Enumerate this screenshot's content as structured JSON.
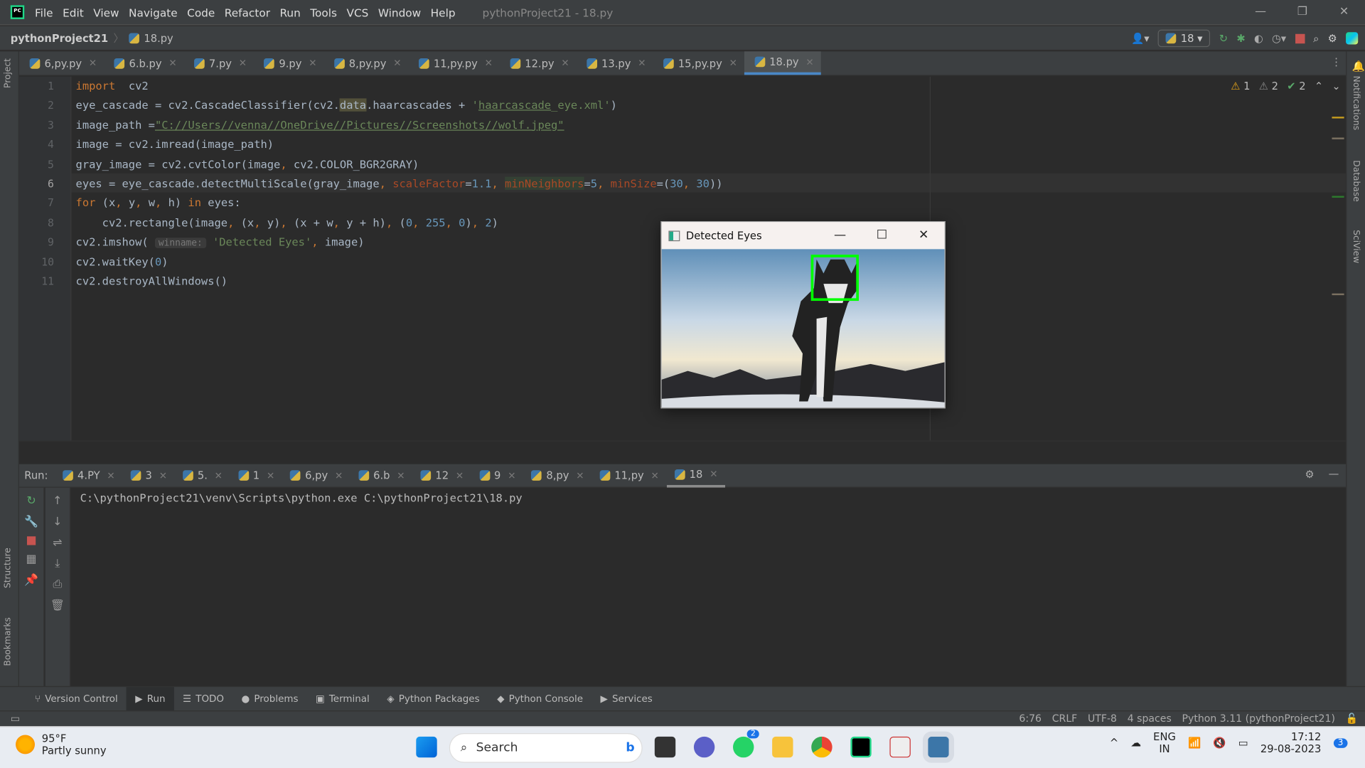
{
  "menubar": {
    "items": [
      "File",
      "Edit",
      "View",
      "Navigate",
      "Code",
      "Refactor",
      "Run",
      "Tools",
      "VCS",
      "Window",
      "Help"
    ],
    "title": "pythonProject21 - 18.py"
  },
  "navbar": {
    "project": "pythonProject21",
    "file": "18.py",
    "run_config": "18"
  },
  "editor_tabs": [
    "6,py.py",
    "6.b.py",
    "7.py",
    "9.py",
    "8,py.py",
    "11,py.py",
    "12.py",
    "13.py",
    "15,py.py",
    "18.py"
  ],
  "active_tab": "18.py",
  "inspections": {
    "errors": "1",
    "warnings": "2",
    "typos": "2"
  },
  "left_strip": {
    "project": "Project",
    "structure": "Structure",
    "bookmarks": "Bookmarks"
  },
  "right_strip": {
    "notifications": "Notifications",
    "database": "Database",
    "sciview": "SciView"
  },
  "code": {
    "line_numbers": [
      "1",
      "2",
      "3",
      "4",
      "5",
      "6",
      "7",
      "8",
      "9",
      "10",
      "11"
    ],
    "lines": [
      [
        [
          "kw",
          "import"
        ],
        [
          "",
          "  cv2"
        ]
      ],
      [
        [
          "",
          "eye_cascade = cv2.CascadeClassifier(cv2."
        ],
        [
          "hl1",
          "data"
        ],
        [
          "",
          ".haarcascades + "
        ],
        [
          "str",
          "'"
        ],
        [
          "str ul",
          "haarcascade"
        ],
        [
          "str",
          "_eye.xml'"
        ],
        [
          "",
          ")"
        ]
      ],
      [
        [
          "",
          "image_path ="
        ],
        [
          "str ul",
          "\"C://Users//venna//OneDrive//Pictures//Screenshots//wolf.jpeg\""
        ]
      ],
      [
        [
          "",
          "image = cv2.imread(image_path)"
        ]
      ],
      [
        [
          "",
          "gray_image = cv2.cvtColor(image"
        ],
        [
          "kw",
          ", "
        ],
        [
          "",
          "cv2.COLOR_BGR2GRAY)"
        ]
      ],
      [
        [
          "",
          "eyes = eye_cascade.detectMultiScale(gray_image"
        ],
        [
          "kw",
          ", "
        ],
        [
          "prm",
          "scaleFactor"
        ],
        [
          "",
          "="
        ],
        [
          "num",
          "1.1"
        ],
        [
          "kw",
          ", "
        ],
        [
          "prm hl2",
          "minNeighbors"
        ],
        [
          "",
          "="
        ],
        [
          "num",
          "5"
        ],
        [
          "kw",
          ", "
        ],
        [
          "prm",
          "minSize"
        ],
        [
          "",
          "=("
        ],
        [
          "num",
          "30"
        ],
        [
          "kw",
          ", "
        ],
        [
          "num",
          "30"
        ],
        [
          "",
          "))"
        ]
      ],
      [
        [
          "kw",
          "for"
        ],
        [
          "",
          " (x"
        ],
        [
          "kw",
          ", "
        ],
        [
          "",
          "y"
        ],
        [
          "kw",
          ", "
        ],
        [
          "",
          "w"
        ],
        [
          "kw",
          ", "
        ],
        [
          "",
          "h) "
        ],
        [
          "kw",
          "in"
        ],
        [
          "",
          " eyes:"
        ]
      ],
      [
        [
          "",
          "    cv2.rectangle(image"
        ],
        [
          "kw",
          ", "
        ],
        [
          "",
          "(x"
        ],
        [
          "kw",
          ", "
        ],
        [
          "",
          "y)"
        ],
        [
          "kw",
          ", "
        ],
        [
          "",
          "(x + w"
        ],
        [
          "kw",
          ", "
        ],
        [
          "",
          "y + h)"
        ],
        [
          "kw",
          ", "
        ],
        [
          "",
          "("
        ],
        [
          "num",
          "0"
        ],
        [
          "kw",
          ", "
        ],
        [
          "num",
          "255"
        ],
        [
          "kw",
          ", "
        ],
        [
          "num",
          "0"
        ],
        [
          "",
          ")"
        ],
        [
          "kw",
          ", "
        ],
        [
          "num",
          "2"
        ],
        [
          "",
          ")"
        ]
      ],
      [
        [
          "",
          "cv2.imshow( "
        ],
        [
          "hint",
          "winname:"
        ],
        [
          "str",
          " 'Detected Eyes'"
        ],
        [
          "kw",
          ", "
        ],
        [
          "",
          "image)"
        ]
      ],
      [
        [
          "",
          "cv2.waitKey("
        ],
        [
          "num",
          "0"
        ],
        [
          "",
          ")"
        ]
      ],
      [
        [
          "",
          "cv2.destroyAllWindows()"
        ]
      ]
    ]
  },
  "run": {
    "label": "Run:",
    "tabs": [
      "4.PY",
      "3",
      "5.",
      "1",
      "6,py",
      "6.b",
      "12",
      "9",
      "8,py",
      "11,py",
      "18"
    ],
    "active": "18",
    "output": "C:\\pythonProject21\\venv\\Scripts\\python.exe C:\\pythonProject21\\18.py"
  },
  "tool_windows": [
    "Version Control",
    "Run",
    "TODO",
    "Problems",
    "Terminal",
    "Python Packages",
    "Python Console",
    "Services"
  ],
  "status": {
    "position": "6:76",
    "line_sep": "CRLF",
    "encoding": "UTF-8",
    "indent": "4 spaces",
    "interpreter": "Python 3.11 (pythonProject21)"
  },
  "cv_window": {
    "title": "Detected Eyes",
    "min": "—",
    "max": "☐",
    "close": "✕"
  },
  "taskbar": {
    "temp": "95°F",
    "weather": "Partly sunny",
    "search": "Search",
    "whatsapp_badge": "2",
    "lang1": "ENG",
    "lang2": "IN",
    "time": "17:12",
    "date": "29-08-2023",
    "notif": "3"
  }
}
